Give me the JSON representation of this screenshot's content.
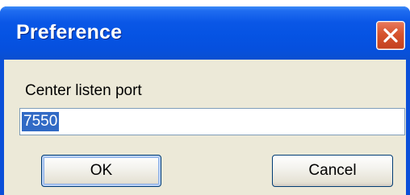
{
  "dialog": {
    "title": "Preference",
    "close_icon": "close-icon",
    "field_label": "Center listen port",
    "port_value": "7550",
    "ok_label": "OK",
    "cancel_label": "Cancel"
  },
  "colors": {
    "titlebar": "#0553e3",
    "client_bg": "#ece9d8",
    "close_button": "#d6532d",
    "selection": "#316ac5",
    "field_border": "#7f9db9"
  }
}
